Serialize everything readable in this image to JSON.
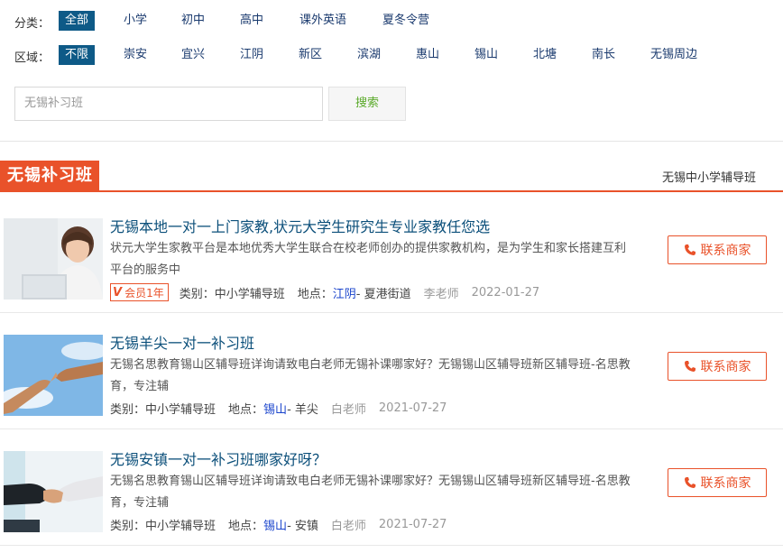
{
  "filters": {
    "category": {
      "label": "分类：",
      "options": [
        "全部",
        "小学",
        "初中",
        "高中",
        "课外英语",
        "夏冬令营"
      ],
      "selected": "全部"
    },
    "area": {
      "label": "区域：",
      "options": [
        "不限",
        "崇安",
        "宜兴",
        "江阴",
        "新区",
        "滨湖",
        "惠山",
        "锡山",
        "北塘",
        "南长",
        "无锡周边"
      ],
      "selected": "不限"
    }
  },
  "search": {
    "placeholder": "无锡补习班",
    "button": "搜索"
  },
  "section": {
    "title": "无锡补习班",
    "right_link": "无锡中小学辅导班"
  },
  "colors": {
    "accent": "#e9522a",
    "chip_active": "#0e5a87",
    "title_link": "#0b4f7a",
    "search_text": "#5aaa2a"
  },
  "listings": [
    {
      "title": "无锡本地一对一上门家教,状元大学生研究生专业家教任您选",
      "desc": "状元大学生家教平台是本地优秀大学生联合在校老师创办的提供家教机构，是为学生和家长搭建互利平台的服务中",
      "badge": "会员1年",
      "badge_icon": "V",
      "category_label": "类别：",
      "category": "中小学辅导班",
      "location_label": "地点：",
      "district": "江阴",
      "street": " - 夏港街道",
      "teacher": "李老师",
      "date": "2022-01-27",
      "contact": "联系商家",
      "image": "woman-with-laptop"
    },
    {
      "title": "无锡羊尖一对一补习班",
      "desc": "无锡名思教育锡山区辅导班详询请致电白老师无锡补课哪家好？无锡锡山区辅导班新区辅导班-名思教育，专注辅",
      "badge": "",
      "badge_icon": "",
      "category_label": "类别：",
      "category": "中小学辅导班",
      "location_label": "地点：",
      "district": "锡山",
      "street": " - 羊尖",
      "teacher": "白老师",
      "date": "2021-07-27",
      "contact": "联系商家",
      "image": "reaching-hands-sky"
    },
    {
      "title": "无锡安镇一对一补习班哪家好呀？",
      "desc": "无锡名思教育锡山区辅导班详询请致电白老师无锡补课哪家好？无锡锡山区辅导班新区辅导班-名思教育，专注辅",
      "badge": "",
      "badge_icon": "",
      "category_label": "类别：",
      "category": "中小学辅导班",
      "location_label": "地点：",
      "district": "锡山",
      "street": " - 安镇",
      "teacher": "白老师",
      "date": "2021-07-27",
      "contact": "联系商家",
      "image": "business-handshake"
    }
  ]
}
